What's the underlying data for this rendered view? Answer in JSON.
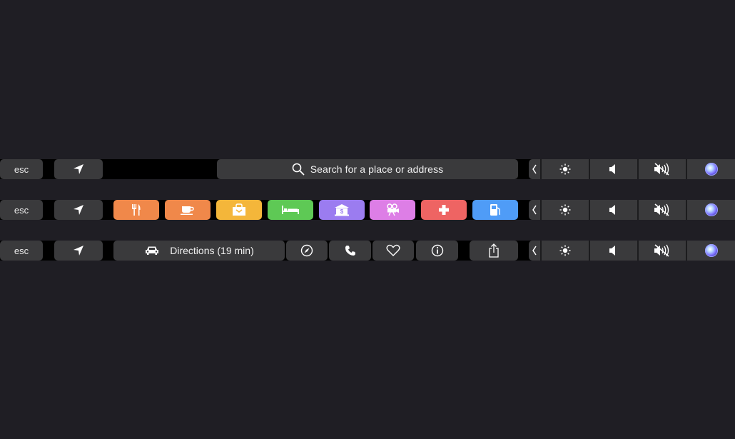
{
  "rows": [
    {
      "esc_label": "esc",
      "search": {
        "text": "Search for a place or address"
      }
    },
    {
      "esc_label": "esc",
      "categories": [
        {
          "name": "restaurants",
          "icon": "fork-knife-icon",
          "color": "#f0884a"
        },
        {
          "name": "coffee",
          "icon": "coffee-cup-icon",
          "color": "#f0884a"
        },
        {
          "name": "shopping",
          "icon": "shopping-bag-icon",
          "color": "#f4b63a"
        },
        {
          "name": "hotels",
          "icon": "bed-icon",
          "color": "#5ec955"
        },
        {
          "name": "banks",
          "icon": "bank-icon",
          "color": "#9b7cf0"
        },
        {
          "name": "movies",
          "icon": "movie-camera-icon",
          "color": "#dd7ee6"
        },
        {
          "name": "hospitals",
          "icon": "medical-cross-icon",
          "color": "#ee6463"
        },
        {
          "name": "gas-stations",
          "icon": "gas-pump-icon",
          "color": "#4f9cf7"
        }
      ]
    },
    {
      "esc_label": "esc",
      "directions_label": "Directions (19 min)",
      "actions": [
        "compass-icon",
        "phone-icon",
        "heart-icon",
        "info-icon",
        "share-icon"
      ]
    }
  ],
  "control_strip": [
    "chevron-left-icon",
    "brightness-icon",
    "volume-icon",
    "mute-icon",
    "siri-icon"
  ]
}
